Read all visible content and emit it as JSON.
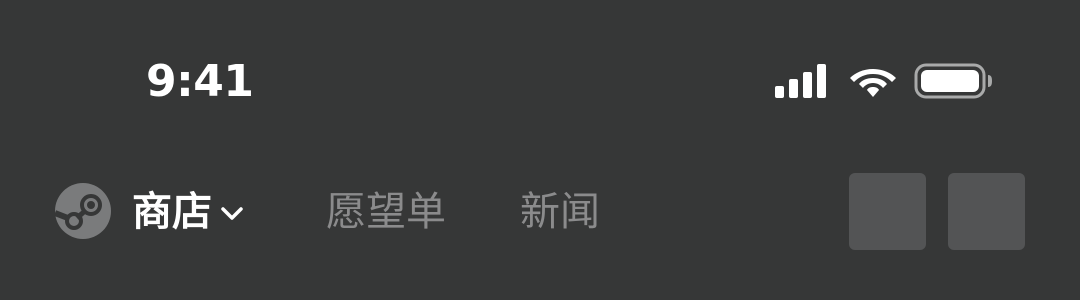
{
  "status_bar": {
    "time": "9:41",
    "icons": [
      "signal-icon",
      "wifi-icon",
      "battery-icon"
    ]
  },
  "nav": {
    "logo_icon": "steam-logo-icon",
    "store_label": "商店",
    "store_dropdown_icon": "chevron-down-icon",
    "tabs": [
      {
        "label": "愿望单"
      },
      {
        "label": "新闻"
      }
    ],
    "action_buttons": [
      "placeholder-button",
      "placeholder-button"
    ]
  },
  "colors": {
    "background": "#363737",
    "text_primary": "#ffffff",
    "text_muted": "#8b8b8c",
    "button_placeholder": "#535455",
    "logo_gray": "#7a7b7c"
  }
}
